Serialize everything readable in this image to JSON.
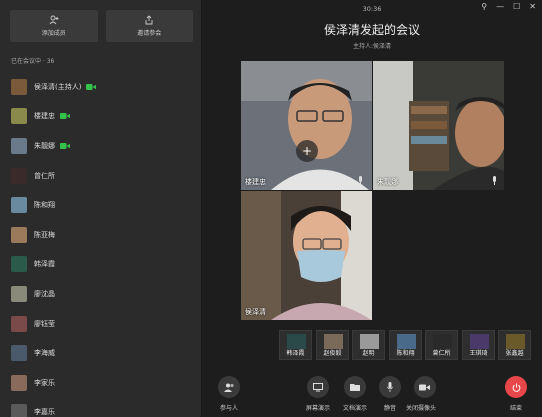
{
  "sidebar": {
    "add_member": "添加成员",
    "invite": "邀请参会",
    "count_label": "已在会议中 · 36",
    "participants": [
      {
        "name": "侯泽清(主持人)",
        "camera": true,
        "avatar_color": "#7a5a3a"
      },
      {
        "name": "楼建忠",
        "camera": true,
        "avatar_color": "#8a8a4a"
      },
      {
        "name": "朱靓娜",
        "camera": true,
        "avatar_color": "#6a7a8a"
      },
      {
        "name": "曾仁所",
        "camera": false,
        "avatar_color": "#3a2a2a"
      },
      {
        "name": "陈和翔",
        "camera": false,
        "avatar_color": "#6a8aa0"
      },
      {
        "name": "陈亚梅",
        "camera": false,
        "avatar_color": "#9a7a5a"
      },
      {
        "name": "韩泽霞",
        "camera": false,
        "avatar_color": "#2a5a4a"
      },
      {
        "name": "廖沈晶",
        "camera": false,
        "avatar_color": "#8a8a7a"
      },
      {
        "name": "廖钰莹",
        "camera": false,
        "avatar_color": "#7a4a4a"
      },
      {
        "name": "李海威",
        "camera": false,
        "avatar_color": "#4a5a6a"
      },
      {
        "name": "李家乐",
        "camera": false,
        "avatar_color": "#8a6a5a"
      },
      {
        "name": "李嘉乐",
        "camera": false,
        "avatar_color": "#5a5a5a"
      }
    ]
  },
  "main": {
    "clock": "30:36",
    "title": "侯泽清发起的会议",
    "host": "主持人:侯泽清",
    "videos": [
      {
        "label": "楼建忠"
      },
      {
        "label": "朱靓娜"
      },
      {
        "label": "侯泽清"
      }
    ],
    "thumbnails": [
      {
        "name": "韩泽霞",
        "color": "#2a4a4a"
      },
      {
        "name": "赵俊毅",
        "color": "#7a6a5a"
      },
      {
        "name": "赵明",
        "color": "#9a9a9a"
      },
      {
        "name": "陈和翔",
        "color": "#4a6a8a"
      },
      {
        "name": "曾仁所",
        "color": "#2a2a2a"
      },
      {
        "name": "王琪琦",
        "color": "#4a3a6a"
      },
      {
        "name": "张鑫越",
        "color": "#6a5a2a"
      }
    ]
  },
  "toolbar": {
    "participants": "参与人",
    "screen_share": "屏幕演示",
    "doc_share": "文档演示",
    "mute": "静音",
    "camera_off": "关闭摄像头",
    "end": "结束"
  },
  "colors": {
    "camera_green": "#35c24a",
    "end_red": "#e8474a",
    "toolbar_circle": "#3a3a3a"
  }
}
